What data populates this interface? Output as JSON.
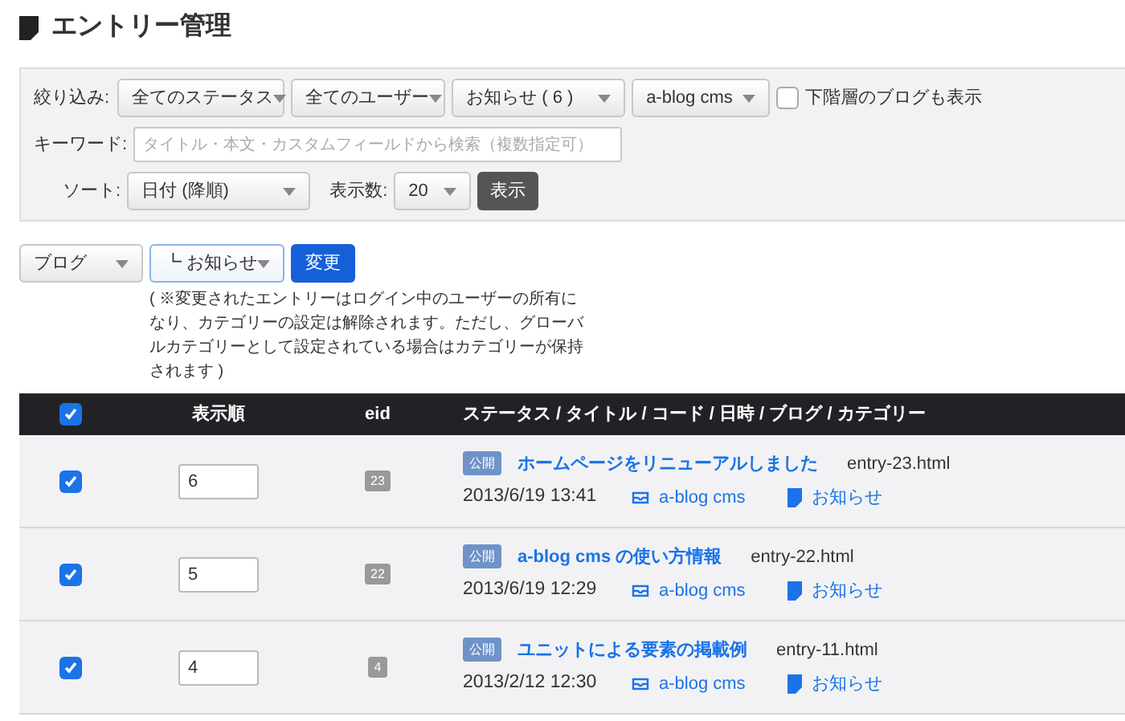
{
  "page_title": "エントリー管理",
  "filters": {
    "label": "絞り込み:",
    "dropdowns": [
      {
        "value": "全てのステータス"
      },
      {
        "value": "全てのユーザー"
      },
      {
        "value": "お知らせ ( 6 )"
      },
      {
        "value": "a-blog cms"
      }
    ],
    "include_children": {
      "label": "下階層のブログも表示",
      "checked": false
    },
    "keyword_label": "キーワード:",
    "keyword_placeholder": "タイトル・本文・カスタムフィールドから検索（複数指定可）",
    "sort_label": "ソート:",
    "sort_value": "日付 (降順)",
    "count_label": "表示数:",
    "count_value": "20",
    "show_button": "表示"
  },
  "bulk": {
    "blog_value": "ブログ",
    "category_value": "┗ お知らせ",
    "change_button": "変更",
    "note": "( ※変更されたエントリーはログイン中のユーザーの所有になり、カテゴリーの設定は解除されます。ただし、グローバルカテゴリーとして設定されている場合はカテゴリーが保持されます )"
  },
  "table": {
    "select_all_checked": true,
    "columns": [
      "表示順",
      "eid",
      "ステータス / タイトル / コード / 日時 / ブログ / カテゴリー"
    ],
    "rows": [
      {
        "checked": true,
        "order": "6",
        "eid": "23",
        "status": "公開",
        "title": "ホームページをリニューアルしました",
        "code": "entry-23.html",
        "datetime": "2013/6/19 13:41",
        "blog": "a-blog cms",
        "category": "お知らせ"
      },
      {
        "checked": true,
        "order": "5",
        "eid": "22",
        "status": "公開",
        "title": "a-blog cms の使い方情報",
        "code": "entry-22.html",
        "datetime": "2013/6/19 12:29",
        "blog": "a-blog cms",
        "category": "お知らせ"
      },
      {
        "checked": true,
        "order": "4",
        "eid": "4",
        "status": "公開",
        "title": "ユニットによる要素の掲載例",
        "code": "entry-11.html",
        "datetime": "2013/2/12 12:30",
        "blog": "a-blog cms",
        "category": "お知らせ"
      }
    ]
  }
}
